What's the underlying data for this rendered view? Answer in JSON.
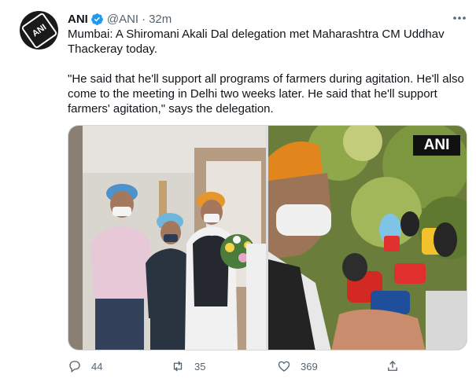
{
  "tweet": {
    "avatar_label": "ANI",
    "author": {
      "name": "ANI",
      "handle": "@ANI",
      "time": "32m"
    },
    "text": {
      "line1": "Mumbai: A Shiromani Akali Dal delegation met Maharashtra CM Uddhav Thackeray today.",
      "line2": "\"He said that he'll support all programs of farmers during agitation. He'll also come to the meeting in Delhi two weeks later. He said that he'll support farmers' agitation,\" says the delegation."
    },
    "media": {
      "watermark": "ANI"
    },
    "stats": {
      "replies": "44",
      "retweets": "35",
      "likes": "369"
    }
  },
  "colors": {
    "text": "#0f1419",
    "secondary": "#536471",
    "verified": "#1d9bf0"
  },
  "icons": [
    "verified-badge-icon",
    "more-icon",
    "reply-icon",
    "retweet-icon",
    "like-icon",
    "share-icon"
  ]
}
